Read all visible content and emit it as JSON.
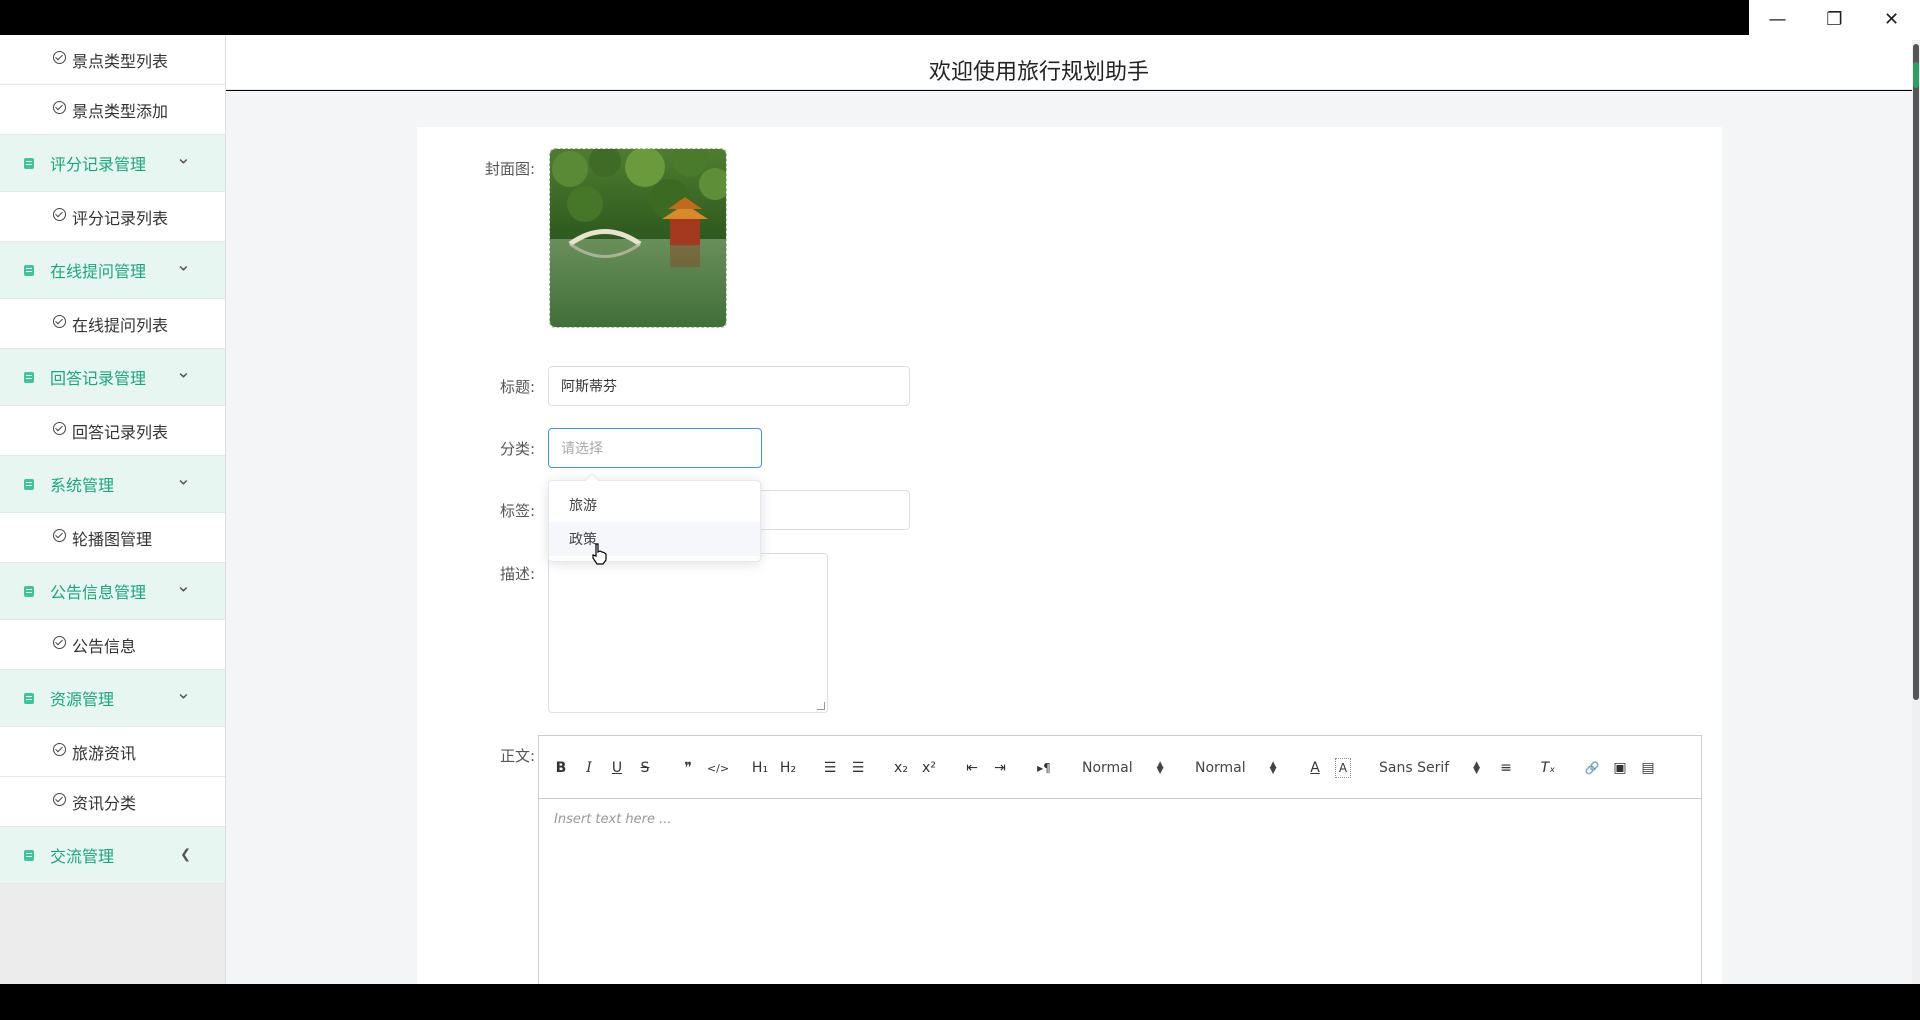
{
  "window": {
    "minimize_glyph": "—",
    "restore_glyph": "❐",
    "close_glyph": "✕"
  },
  "header": {
    "title": "欢迎使用旅行规划助手"
  },
  "sidebar": {
    "items": [
      {
        "type": "sub",
        "label": "景点类型列表"
      },
      {
        "type": "sub",
        "label": "景点类型添加"
      },
      {
        "type": "group",
        "label": "评分记录管理",
        "chevron": "down"
      },
      {
        "type": "sub",
        "label": "评分记录列表"
      },
      {
        "type": "group",
        "label": "在线提问管理",
        "chevron": "down"
      },
      {
        "type": "sub",
        "label": "在线提问列表"
      },
      {
        "type": "group",
        "label": "回答记录管理",
        "chevron": "down"
      },
      {
        "type": "sub",
        "label": "回答记录列表"
      },
      {
        "type": "group",
        "label": "系统管理",
        "chevron": "down"
      },
      {
        "type": "sub",
        "label": "轮播图管理"
      },
      {
        "type": "group",
        "label": "公告信息管理",
        "chevron": "down"
      },
      {
        "type": "sub",
        "label": "公告信息"
      },
      {
        "type": "group",
        "label": "资源管理",
        "chevron": "down"
      },
      {
        "type": "sub",
        "label": "旅游资讯"
      },
      {
        "type": "sub",
        "label": "资讯分类"
      },
      {
        "type": "group",
        "label": "交流管理",
        "chevron": "left"
      }
    ]
  },
  "form": {
    "cover_label": "封面图:",
    "title_label": "标题:",
    "title_value": "阿斯蒂芬",
    "category_label": "分类:",
    "category_placeholder": "请选择",
    "tags_label": "标签:",
    "description_label": "描述:",
    "body_label": "正文:",
    "category_options": [
      "旅游",
      "政策"
    ],
    "hovered_option": "政策"
  },
  "editor": {
    "toolbar": {
      "bold": "B",
      "italic": "I",
      "underline": "U",
      "strike": "S",
      "blockquote": "❞",
      "code": "</>",
      "h1": "H₁",
      "h2": "H₂",
      "ordered_list": "☰",
      "bullet_list": "☰",
      "subscript": "x₂",
      "superscript": "x²",
      "outdent": "⇤",
      "indent": "⇥",
      "rtl": "▸¶",
      "size_select": "Normal",
      "header_select": "Normal",
      "color": "A",
      "background": "A",
      "font_select": "Sans Serif",
      "align": "≡",
      "clean": "Tₓ",
      "link": "🔗",
      "image": "▣",
      "video": "▤"
    },
    "placeholder": "Insert text here ..."
  },
  "colors": {
    "accent": "#1ba57d",
    "group_bg": "#e8f6f1",
    "focus_border": "#4a90e2"
  }
}
